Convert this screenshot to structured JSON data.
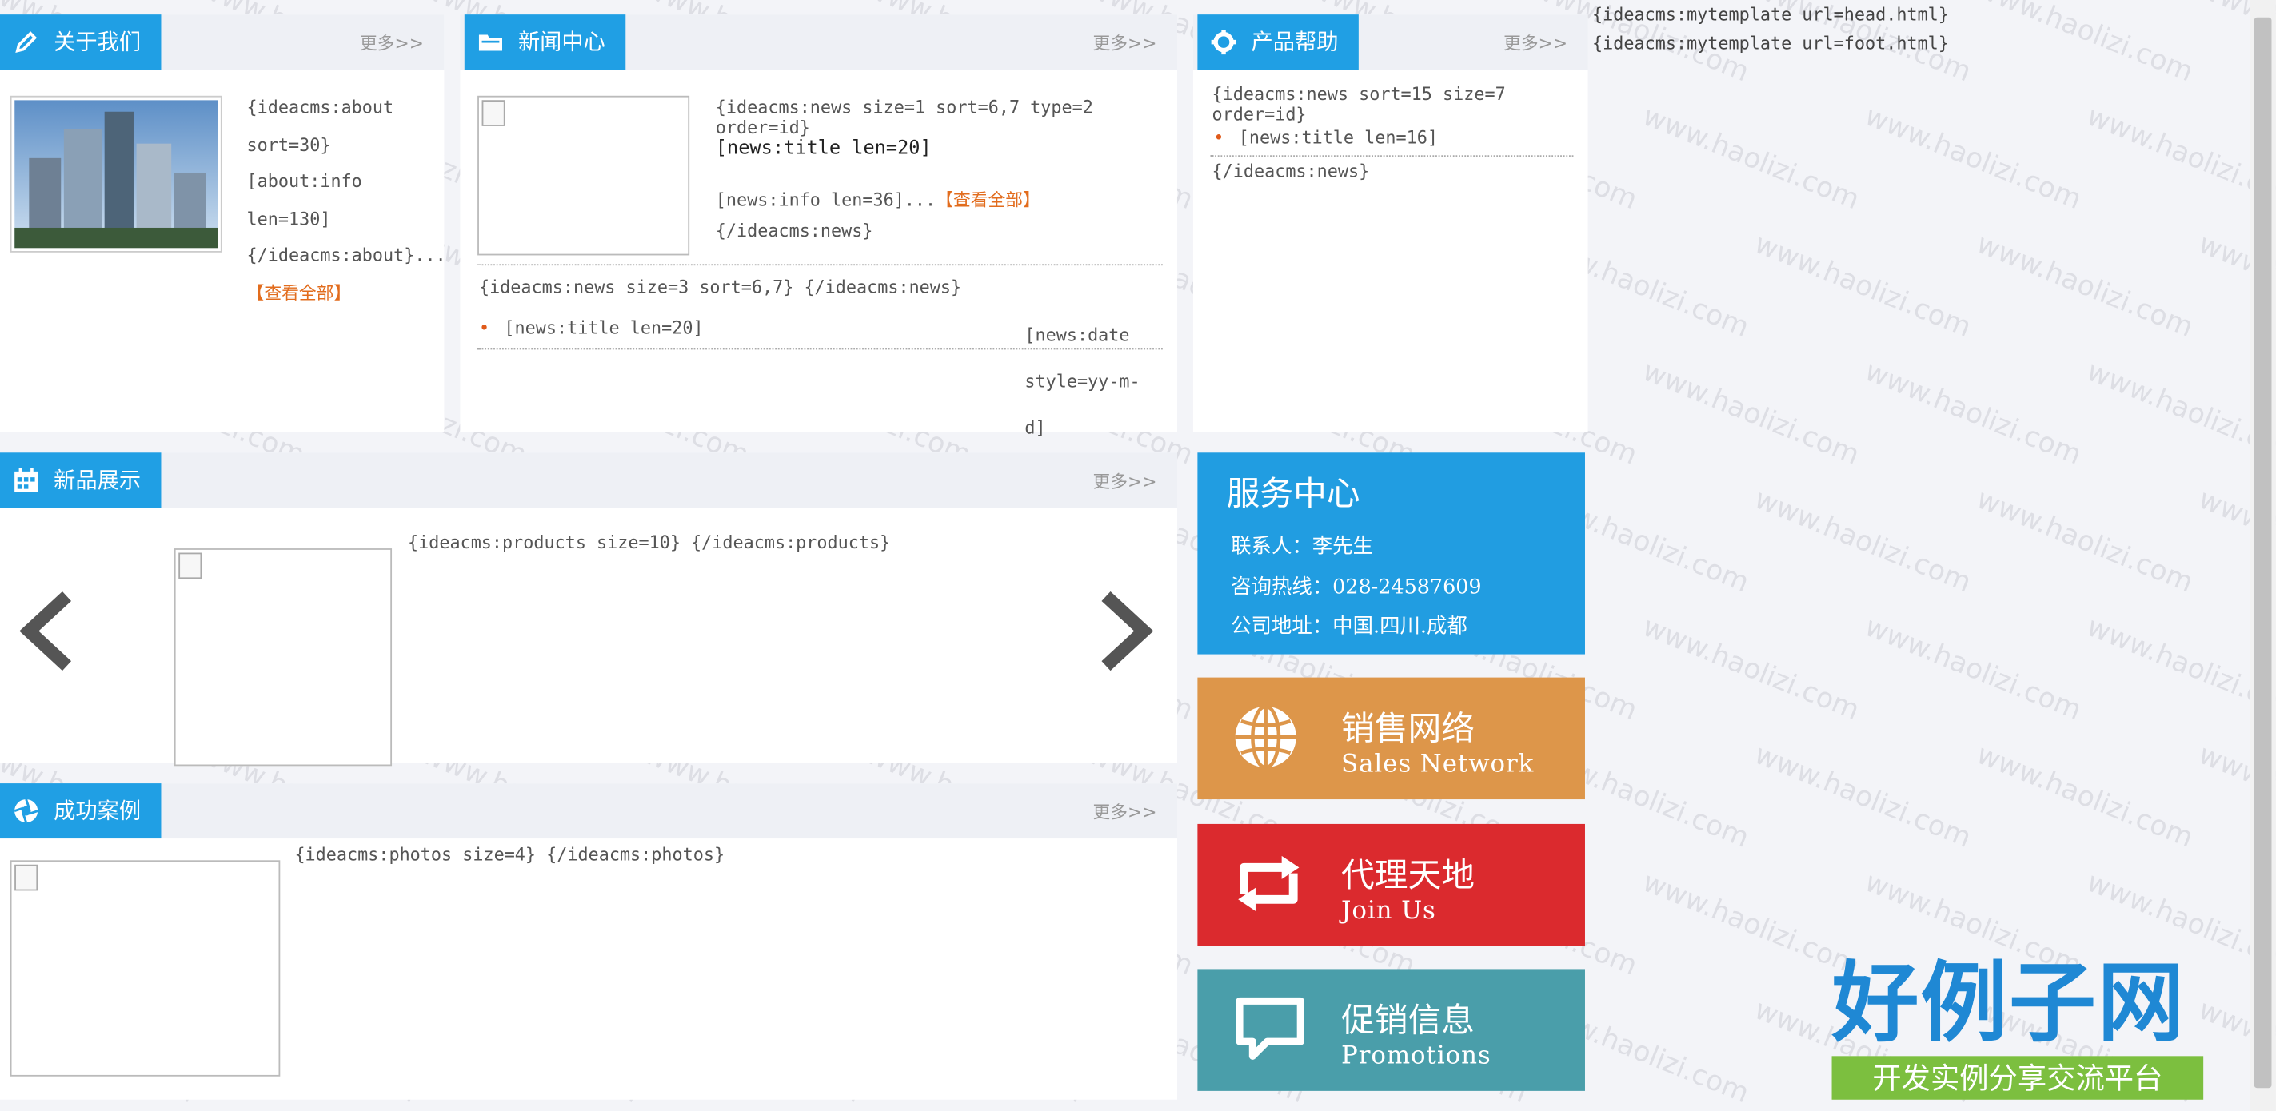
{
  "panels": {
    "about": {
      "title": "关于我们",
      "more": "更多>>",
      "text": "{ideacms:about sort=30}[about:info len=130] {/ideacms:about}...",
      "link": "【查看全部】"
    },
    "news": {
      "title": "新闻中心",
      "more": "更多>>",
      "featured_code": "{ideacms:news size=1 sort=6,7 type=2 order=id}",
      "featured_title": "[news:title len=20]",
      "featured_info": "[news:info len=36]...",
      "featured_link": "【查看全部】",
      "featured_close": "{/ideacms:news}",
      "list_code": "{ideacms:news size=3 sort=6,7} {/ideacms:news}",
      "list_item_title": "[news:title len=20]",
      "list_item_date": "[news:date style=yy-m-d]"
    },
    "help": {
      "title": "产品帮助",
      "more": "更多>>",
      "code": "{ideacms:news sort=15 size=7 order=id}",
      "item": "[news:title len=16]",
      "close": "{/ideacms:news}"
    },
    "products": {
      "title": "新品展示",
      "more": "更多>>",
      "code": "{ideacms:products size=10} {/ideacms:products}",
      "prev": "‹",
      "next": "›"
    },
    "cases": {
      "title": "成功案例",
      "more": "更多>>",
      "code": "{ideacms:photos size=4} {/ideacms:photos}"
    }
  },
  "service": {
    "title": "服务中心",
    "contact": "联系人：李先生",
    "hotline": "咨询热线：028-24587609",
    "address": "公司地址：中国.四川.成都"
  },
  "banners": [
    {
      "cn": "销售网络",
      "en": "Sales Network",
      "color": "#dd964a",
      "icon": "globe-icon"
    },
    {
      "cn": "代理天地",
      "en": "Join Us",
      "color": "#db2a2e",
      "icon": "refresh-icon"
    },
    {
      "cn": "促销信息",
      "en": "Promotions",
      "color": "#4a9eaa",
      "icon": "chat-icon"
    }
  ],
  "template_text": "{ideacms:mytemplate url=head.html} {ideacms:mytemplate url=foot.html}",
  "watermark": {
    "url": "www.haolizi.com",
    "logo": "好例子网",
    "slogan": "开发实例分享交流平台"
  }
}
